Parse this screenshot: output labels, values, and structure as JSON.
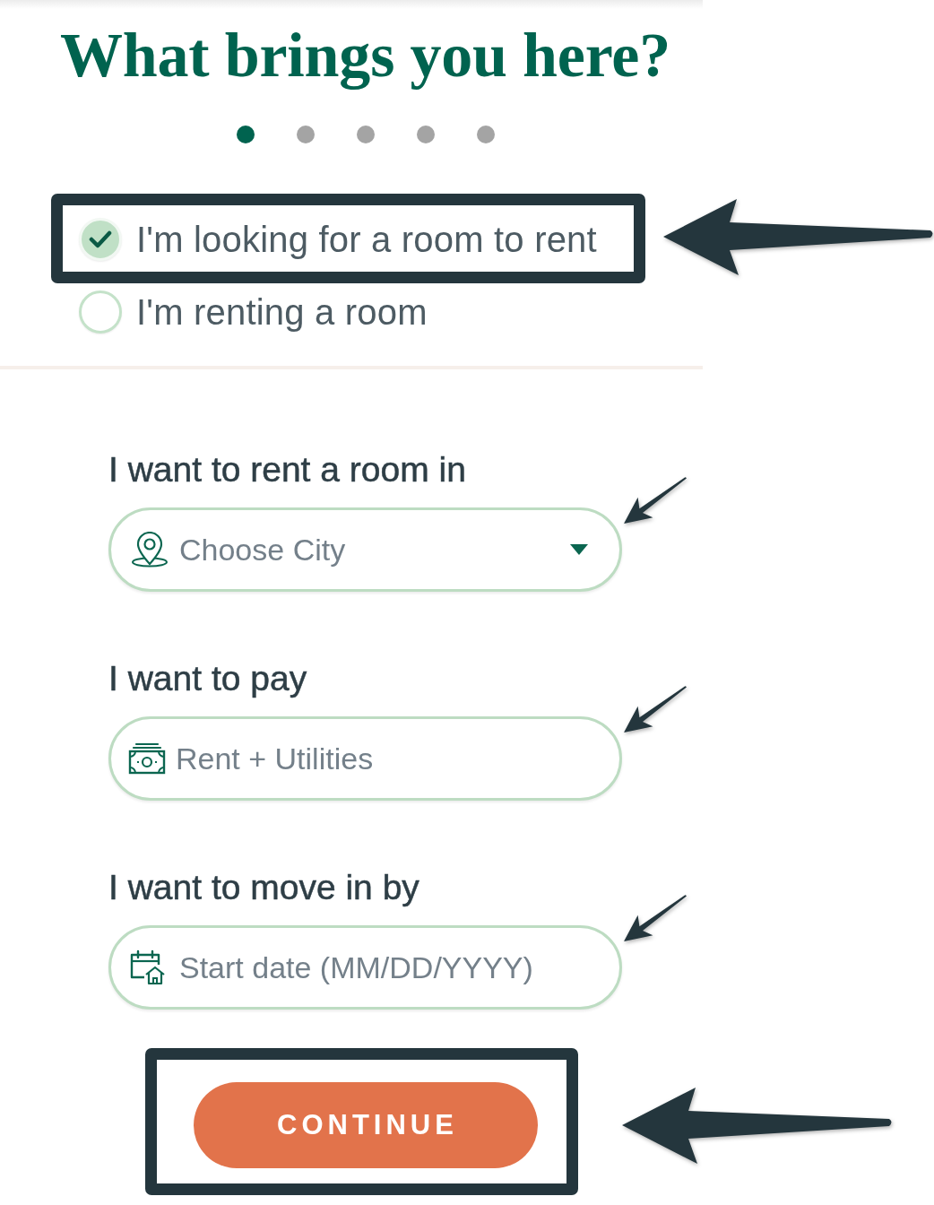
{
  "title": "What brings you here?",
  "steps": [
    {
      "selected": true
    },
    {
      "selected": false
    },
    {
      "selected": false
    },
    {
      "selected": false
    },
    {
      "selected": false
    }
  ],
  "options": [
    {
      "label": "I'm looking for a room to rent",
      "selected": true,
      "highlighted": true
    },
    {
      "label": "I'm renting a room",
      "selected": false,
      "highlighted": false
    }
  ],
  "fields": [
    {
      "kind": "location",
      "label": "I want to rent a room in",
      "placeholder": "Choose City",
      "pointed_at": true
    },
    {
      "kind": "budget",
      "label": "I want to pay",
      "placeholder": "Rent + Utilities",
      "pointed_at": true
    },
    {
      "kind": "date",
      "label": "I want to move in by",
      "placeholder": "Start date (MM/DD/YYYY)",
      "pointed_at": true
    }
  ],
  "continue_button": {
    "label": "CONTINUE",
    "highlighted": true
  }
}
